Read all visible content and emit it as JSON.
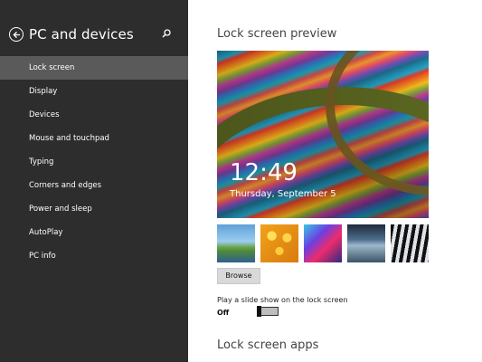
{
  "sidebar": {
    "title": "PC and devices",
    "items": [
      {
        "label": "Lock screen",
        "selected": true
      },
      {
        "label": "Display"
      },
      {
        "label": "Devices"
      },
      {
        "label": "Mouse and touchpad"
      },
      {
        "label": "Typing"
      },
      {
        "label": "Corners and edges"
      },
      {
        "label": "Power and sleep"
      },
      {
        "label": "AutoPlay"
      },
      {
        "label": "PC info"
      }
    ]
  },
  "main": {
    "preview_heading": "Lock screen preview",
    "preview_time": "12:49",
    "preview_date": "Thursday, September 5",
    "thumbnails": [
      "landscape",
      "honeycomb",
      "abstract",
      "bridge",
      "piano"
    ],
    "browse_label": "Browse",
    "slideshow_label": "Play a slide show on the lock screen",
    "slideshow_state": "Off",
    "apps_heading": "Lock screen apps"
  },
  "colors": {
    "sidebar_bg": "#2d2d2d",
    "selected_bg": "#5a5a5a"
  }
}
